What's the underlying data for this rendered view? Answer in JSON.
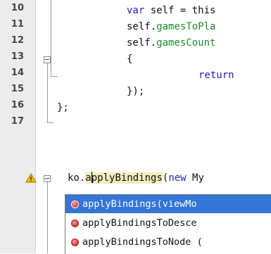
{
  "gutter": {
    "line_numbers": [
      "10",
      "11",
      "12",
      "13",
      "14",
      "15",
      "16",
      "17",
      ""
    ]
  },
  "editor": {
    "lines": {
      "l10": {
        "kw": "var",
        "rest": " self = this"
      },
      "l11": {
        "obj": "self.",
        "field": "gamesToPla"
      },
      "l12": {
        "obj": "self.",
        "field": "gamesCount"
      },
      "l13": {
        "text": "{"
      },
      "l14": {
        "kw": "return"
      },
      "l15": {
        "text": "});"
      },
      "l16": {
        "text": "};"
      },
      "l18": {
        "obj": "ko.",
        "before_caret": "a",
        "after_caret": "pplyBindings",
        "paren": "(",
        "kw": "new",
        "rest": " My"
      }
    }
  },
  "autocomplete": {
    "items": [
      {
        "name": "applyBindings",
        "params": "(viewMo",
        "selected": true,
        "icon": "method-icon"
      },
      {
        "name": "applyBindingsToDesce",
        "params": "",
        "selected": false,
        "icon": "method-icon"
      },
      {
        "name": "applyBindingsToNode",
        "params": " (",
        "selected": false,
        "icon": "method-icon"
      }
    ]
  },
  "colors": {
    "keyword": "#1e22b4",
    "field": "#1e8a2f",
    "selection": "#3475d6",
    "highlight": "#f3ecbd",
    "warning": "#f2c200"
  }
}
